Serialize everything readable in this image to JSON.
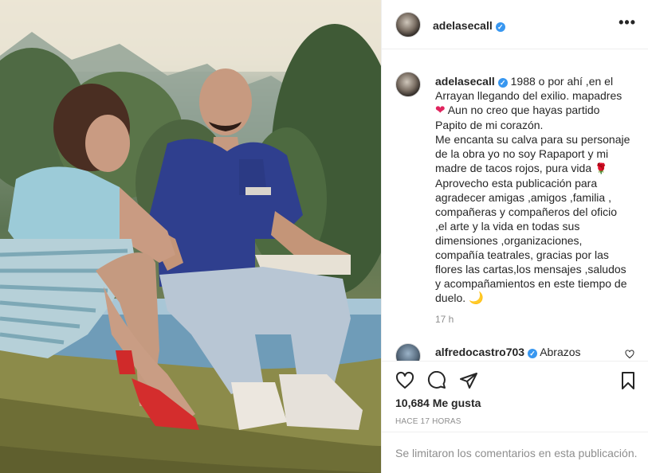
{
  "post": {
    "author": "adelasecall",
    "author_verified": true,
    "caption_lines": [
      "1988 o por ahí ,en el",
      "Arrayan llegando del exilio. mapadres",
      "Aun no creo que hayas partido",
      "Papito de mi corazón.",
      "Me encanta su calva para su personaje",
      "de la obra yo no soy Rapaport y mi",
      "madre de tacos rojos, pura vida",
      "Aprovecho esta publicación para",
      "agradecer amigas ,amigos ,familia ,",
      "compañeras y compañeros del oficio",
      ",el arte y la vida en todas sus",
      "dimensiones ,organizaciones,",
      "compañía teatrales, gracias por las",
      "flores las cartas,los mensajes ,saludos",
      "y acompañamientos en este tiempo de",
      "duelo."
    ],
    "emojis": {
      "heart": "❤",
      "rose": "🌹",
      "moon": "🌙"
    },
    "time_ago": "17 h",
    "likes": "10,684 Me gusta",
    "date": "HACE 17 HORAS",
    "comments_limited": "Se limitaron los comentarios en esta publicación."
  },
  "reply": {
    "author": "alfredocastro703",
    "author_verified": true,
    "text": "Abrazos"
  },
  "icons": {
    "more": "more-options-icon",
    "like": "heart-outline-icon",
    "comment": "comment-bubble-icon",
    "share": "paper-plane-icon",
    "save": "bookmark-icon",
    "verified": "verified-badge-icon"
  },
  "colors": {
    "verified": "#3897f0",
    "heart": "#e0245e",
    "text": "#262626",
    "muted": "#8e8e8e",
    "divider": "#efefef"
  }
}
